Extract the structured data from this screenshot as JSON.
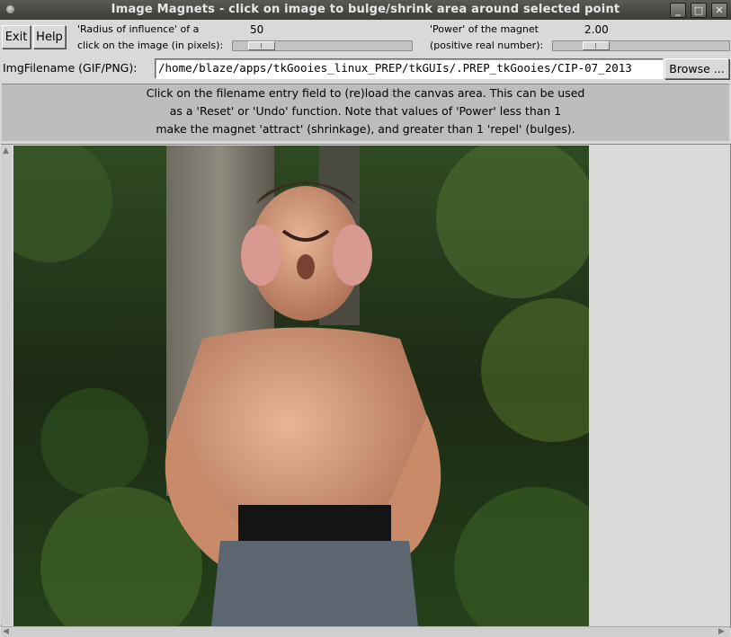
{
  "window": {
    "title": "Image Magnets - click on image to bulge/shrink area around selected point",
    "minimize_glyph": "_",
    "maximize_glyph": "□",
    "close_glyph": "✕"
  },
  "toolbar": {
    "exit_label": "Exit",
    "help_label": "Help",
    "radius_label_1": "'Radius of influence' of a",
    "radius_label_2": "click on the image (in pixels):",
    "radius_value": "50",
    "power_label_1": "'Power' of the magnet",
    "power_label_2": "(positive real number):",
    "power_value": "2.00"
  },
  "sliders": {
    "radius_fraction": 0.1,
    "power_fraction": 0.2
  },
  "file": {
    "label": "ImgFilename (GIF/PNG):",
    "value": "/home/blaze/apps/tkGooies_linux_PREP/tkGUIs/.PREP_tkGooies/CIP-07_2013",
    "browse_label": "Browse ..."
  },
  "message": {
    "line1": "Click on the filename entry field to (re)load the canvas area.  This can be used",
    "line2": "as a 'Reset' or 'Undo' function.  Note that values of 'Power' less than 1",
    "line3": "make the magnet 'attract' (shrinkage), and greater than 1 'repel' (bulges)."
  },
  "canvas": {
    "image_description_icon": "photo-icon"
  }
}
